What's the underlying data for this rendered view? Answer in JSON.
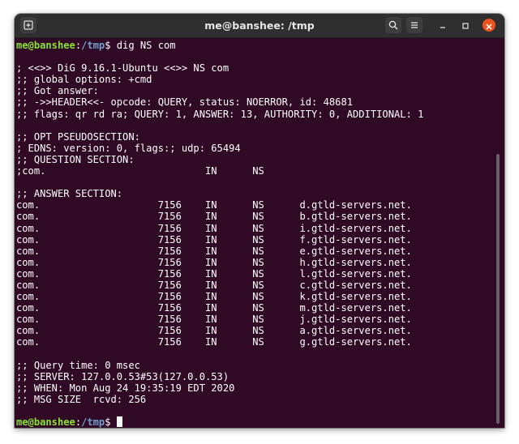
{
  "window": {
    "title": "me@banshee: /tmp"
  },
  "titlebar": {
    "new_tab_icon": "new-tab-icon",
    "search_icon": "search-icon",
    "menu_icon": "hamburger-menu-icon",
    "minimize_icon": "minimize-icon",
    "maximize_icon": "maximize-icon",
    "close_icon": "close-icon",
    "close_color": "#e95420"
  },
  "colors": {
    "terminal_bg": "#300a24",
    "prompt_user": "#8ae234",
    "prompt_path": "#729fcf",
    "text": "#ffffff"
  },
  "prompt": {
    "user_host": "me@banshee",
    "sep": ":",
    "path": "/tmp",
    "symbol": "$ ",
    "command": "dig NS com"
  },
  "output_lines": [
    "",
    "; <<>> DiG 9.16.1-Ubuntu <<>> NS com",
    ";; global options: +cmd",
    ";; Got answer:",
    ";; ->>HEADER<<- opcode: QUERY, status: NOERROR, id: 48681",
    ";; flags: qr rd ra; QUERY: 1, ANSWER: 13, AUTHORITY: 0, ADDITIONAL: 1",
    "",
    ";; OPT PSEUDOSECTION:",
    "; EDNS: version: 0, flags:; udp: 65494",
    ";; QUESTION SECTION:",
    ";com.                           IN      NS",
    "",
    ";; ANSWER SECTION:",
    "com.                    7156    IN      NS      d.gtld-servers.net.",
    "com.                    7156    IN      NS      b.gtld-servers.net.",
    "com.                    7156    IN      NS      i.gtld-servers.net.",
    "com.                    7156    IN      NS      f.gtld-servers.net.",
    "com.                    7156    IN      NS      e.gtld-servers.net.",
    "com.                    7156    IN      NS      h.gtld-servers.net.",
    "com.                    7156    IN      NS      l.gtld-servers.net.",
    "com.                    7156    IN      NS      c.gtld-servers.net.",
    "com.                    7156    IN      NS      k.gtld-servers.net.",
    "com.                    7156    IN      NS      m.gtld-servers.net.",
    "com.                    7156    IN      NS      j.gtld-servers.net.",
    "com.                    7156    IN      NS      a.gtld-servers.net.",
    "com.                    7156    IN      NS      g.gtld-servers.net.",
    "",
    ";; Query time: 0 msec",
    ";; SERVER: 127.0.0.53#53(127.0.0.53)",
    ";; WHEN: Mon Aug 24 19:35:19 EDT 2020",
    ";; MSG SIZE  rcvd: 256",
    ""
  ],
  "final_prompt": {
    "user_host": "me@banshee",
    "sep": ":",
    "path": "/tmp",
    "symbol": "$ "
  }
}
